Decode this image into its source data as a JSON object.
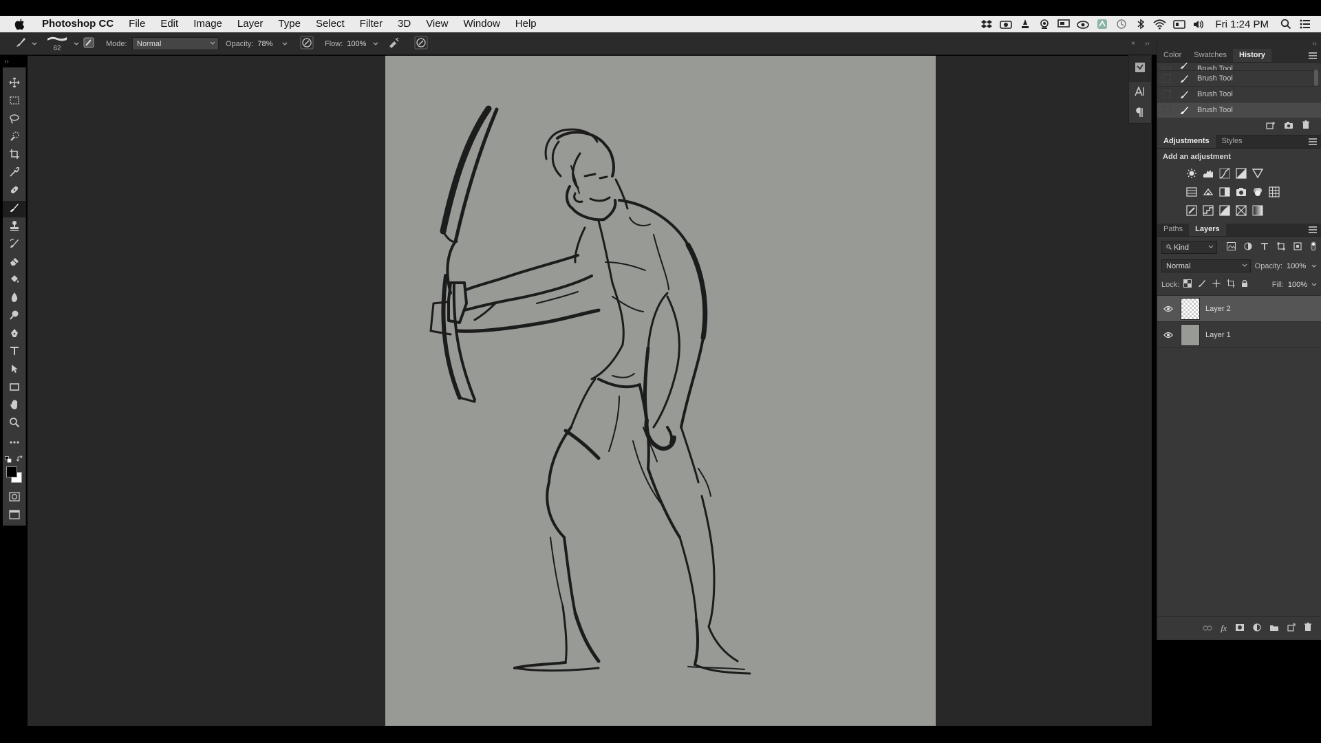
{
  "menubar": {
    "app_name": "Photoshop CC",
    "items": [
      "File",
      "Edit",
      "Image",
      "Layer",
      "Type",
      "Select",
      "Filter",
      "3D",
      "View",
      "Window",
      "Help"
    ],
    "clock": "Fri 1:24 PM"
  },
  "options": {
    "brush_size": "62",
    "mode_label": "Mode:",
    "mode_value": "Normal",
    "opacity_label": "Opacity:",
    "opacity_value": "78%",
    "flow_label": "Flow:",
    "flow_value": "100%"
  },
  "history_panel": {
    "tabs": [
      "Color",
      "Swatches",
      "History"
    ],
    "active_tab": "History",
    "items": [
      "Brush Tool",
      "Brush Tool",
      "Brush Tool",
      "Brush Tool"
    ]
  },
  "adjustments_panel": {
    "tabs": [
      "Adjustments",
      "Styles"
    ],
    "subtitle": "Add an adjustment"
  },
  "layers_panel": {
    "tabs": [
      "Paths",
      "Layers"
    ],
    "filter_label": "Kind",
    "blend_mode": "Normal",
    "opacity_label": "Opacity:",
    "opacity_value": "100%",
    "lock_label": "Lock:",
    "fill_label": "Fill:",
    "fill_value": "100%",
    "layers": [
      {
        "name": "Layer 2",
        "selected": true
      },
      {
        "name": "Layer 1",
        "selected": false
      }
    ]
  },
  "colors": {
    "canvas": "#979a95",
    "ink": "#1c1c1c",
    "workspace": "#282828",
    "panel": "#383838"
  }
}
